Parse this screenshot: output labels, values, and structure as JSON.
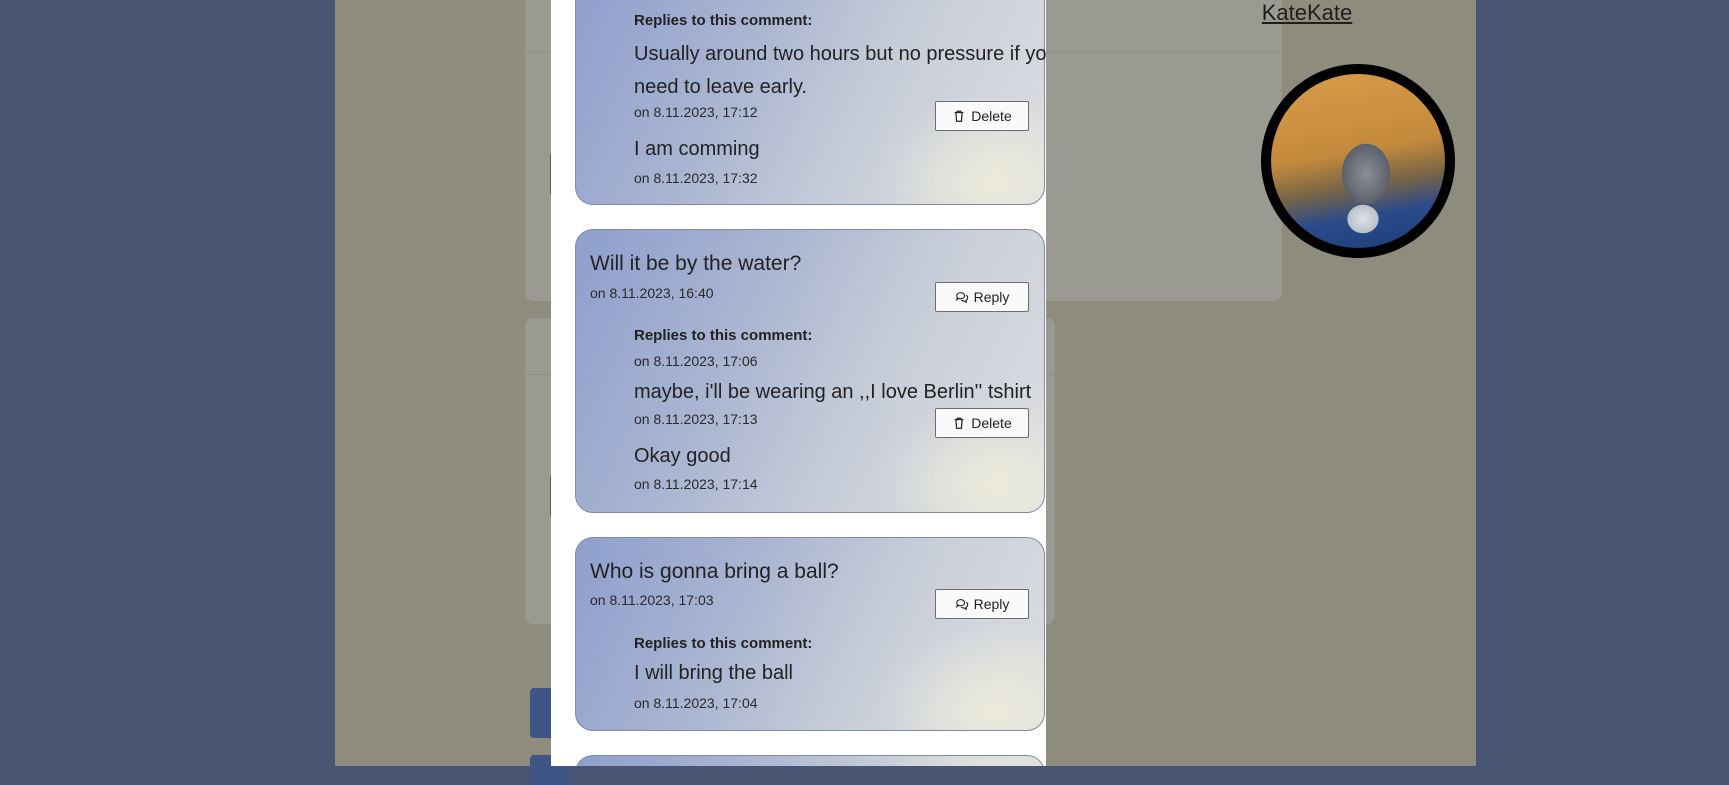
{
  "background": {
    "profile_username": "KateKate"
  },
  "comments": [
    {
      "replies_heading": "Replies to this comment:",
      "replies": [
        {
          "text": "Usually around two hours but no pressure if you need to leave early.",
          "line1": "Usually around two hours but no pressure if you",
          "line2": "need to leave early.",
          "date": "on 8.11.2023, 17:12",
          "action": "Delete"
        },
        {
          "text": "I am comming",
          "date": "on 8.11.2023, 17:32"
        }
      ]
    },
    {
      "title": "Will it be by the water?",
      "date": "on 8.11.2023, 16:40",
      "action": "Reply",
      "replies_heading": "Replies to this comment:",
      "replies": [
        {
          "text": "",
          "date": "on 8.11.2023, 17:06"
        },
        {
          "text": "maybe, i'll be wearing an ,,I love Berlin'' tshirt",
          "date": "on 8.11.2023, 17:13",
          "action": "Delete"
        },
        {
          "text": "Okay good",
          "date": "on 8.11.2023, 17:14"
        }
      ]
    },
    {
      "title": "Who is gonna bring a ball?",
      "date": "on 8.11.2023, 17:03",
      "action": "Reply",
      "replies_heading": "Replies to this comment:",
      "replies": [
        {
          "text": "I will bring the ball",
          "date": "on 8.11.2023, 17:04"
        }
      ]
    }
  ],
  "icons": {
    "reply": "chat-bubbles-icon",
    "delete": "trash-icon"
  },
  "colors": {
    "overlay": "#485573",
    "card_border": "#7f8aa3"
  }
}
